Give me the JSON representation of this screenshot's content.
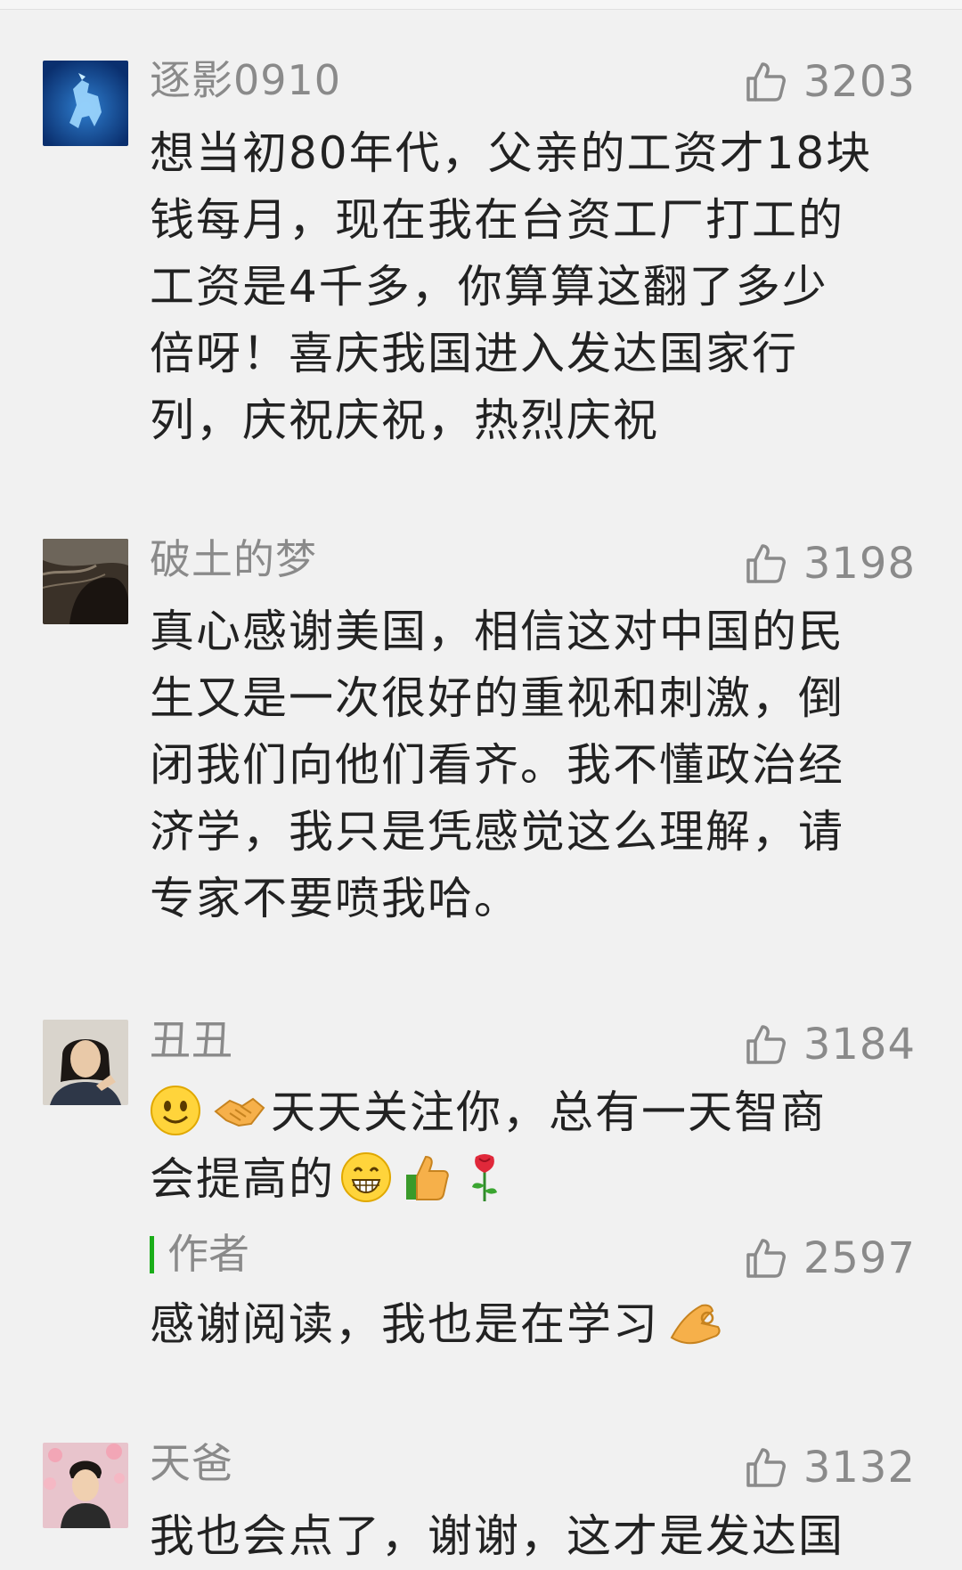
{
  "comments": [
    {
      "nickname": "逐影0910",
      "likes": "3203",
      "text": "想当初80年代，父亲的工资才18块钱每月，现在我在台资工厂打工的工资是4千多，你算算这翻了多少倍呀！喜庆我国进入发达国家行列，庆祝庆祝，热烈庆祝",
      "lines": [
        "想当初80年代，父亲的工资才18块",
        "钱每月，现在我在台资工厂打工的",
        "工资是4千多，你算算这翻了多少",
        "倍呀！喜庆我国进入发达国家行",
        "列，庆祝庆祝，热烈庆祝"
      ]
    },
    {
      "nickname": "破土的梦",
      "likes": "3198",
      "lines": [
        "真心感谢美国，相信这对中国的民",
        "生又是一次很好的重视和刺激，倒",
        "闭我们向他们看齐。我不懂政治经",
        "济学，我只是凭感觉这么理解，请",
        "专家不要喷我哈。"
      ]
    },
    {
      "nickname": "丑丑",
      "likes": "3184",
      "lines": [
        "天天关注你，总有一天智商",
        "会提高的"
      ],
      "emojis": {
        "smile": "☺",
        "handshake": "🤝",
        "grin": "😁",
        "thumbs": "👍",
        "rose": "🌹"
      },
      "reply": {
        "label": "作者",
        "likes": "2597",
        "text": "感谢阅读，我也是在学习",
        "emoji": "👌"
      }
    },
    {
      "nickname": "天爸",
      "likes": "3132",
      "partial_line": "我也会点了，谢谢，这才是发达国"
    }
  ],
  "icons": {
    "like": "thumb-up-outline-icon"
  },
  "colors": {
    "background": "#f1f1f1",
    "nickname": "#8a8a8a",
    "text": "#222222",
    "author_bar": "#1aad19"
  }
}
